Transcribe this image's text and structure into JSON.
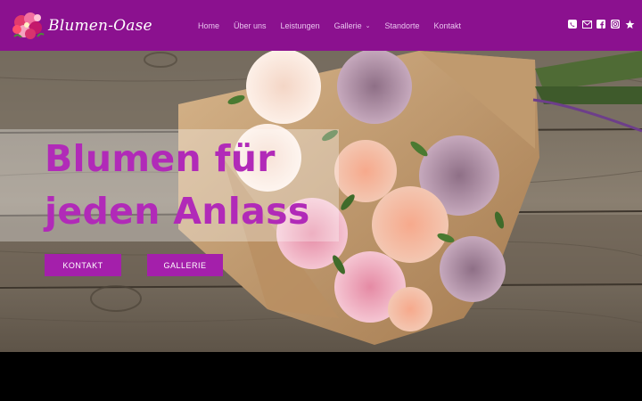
{
  "brand": {
    "name": "Blumen-Oase",
    "color_header": "#8b118f",
    "color_accent": "#b12ab8",
    "color_button": "#a41fab"
  },
  "nav": {
    "items": [
      {
        "label": "Home"
      },
      {
        "label": "Über uns"
      },
      {
        "label": "Leistungen"
      },
      {
        "label": "Gallerie",
        "has_dropdown": true
      },
      {
        "label": "Standorte"
      },
      {
        "label": "Kontakt"
      }
    ]
  },
  "social": {
    "icons": [
      "phone-icon",
      "mail-icon",
      "facebook-icon",
      "instagram-icon",
      "star-icon"
    ]
  },
  "hero": {
    "title_line1": "Blumen für",
    "title_line2": "jeden Anlass",
    "button_kontakt": "KONTAKT",
    "button_gallerie": "GALLERIE"
  }
}
